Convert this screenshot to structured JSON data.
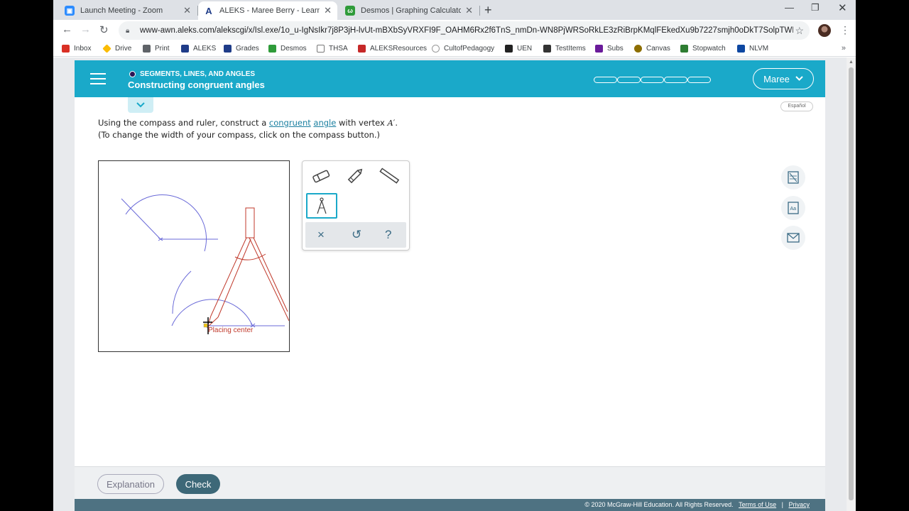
{
  "tabs": [
    {
      "title": "Launch Meeting - Zoom",
      "icon": "zoom-icon",
      "color": "#2d8cff",
      "glyph": "▣"
    },
    {
      "title": "ALEKS - Maree Berry - Learn",
      "icon": "aleks-icon",
      "color": "#1f3c88",
      "glyph": "A"
    },
    {
      "title": "Desmos | Graphing Calculator",
      "icon": "desmos-icon",
      "color": "#2f9b3a",
      "glyph": "ω"
    }
  ],
  "url": "www-awn.aleks.com/alekscgi/x/Isl.exe/1o_u-IgNsIkr7j8P3jH-lvUt-mBXbSyVRXFI9F_OAHM6Rx2f6TnS_nmDn-WN8PjWRSoRkLE3zRiBrpKMqlFEkedXu9b7227smjh0oDkT7SolpTWNTh...",
  "bookmarks": [
    {
      "label": "Inbox",
      "color": "#d93025"
    },
    {
      "label": "Drive",
      "color": "#fbbc04"
    },
    {
      "label": "Print",
      "color": "#5f6368"
    },
    {
      "label": "ALEKS",
      "color": "#1f3c88"
    },
    {
      "label": "Grades",
      "color": "#1f3c88"
    },
    {
      "label": "Desmos",
      "color": "#2f9b3a"
    },
    {
      "label": "THSA",
      "color": "#777777"
    },
    {
      "label": "ALEKSResources",
      "color": "#c62828"
    },
    {
      "label": "CultofPedagogy",
      "color": "#999999"
    },
    {
      "label": "UEN",
      "color": "#222222"
    },
    {
      "label": "TestItems",
      "color": "#333333"
    },
    {
      "label": "Subs",
      "color": "#6a1b9a"
    },
    {
      "label": "Canvas",
      "color": "#8d6e00"
    },
    {
      "label": "Stopwatch",
      "color": "#2e7d32"
    },
    {
      "label": "NLVM",
      "color": "#0d47a1"
    }
  ],
  "header": {
    "topic": "SEGMENTS, LINES, AND ANGLES",
    "title": "Constructing congruent angles",
    "user": "Maree",
    "progress_segments": 5,
    "accent": "#1aa9c9"
  },
  "espanol": "Español",
  "instructions": {
    "pre": "Using the compass and ruler, construct a ",
    "link1": "congruent",
    "link2": "angle",
    "mid": " with vertex ",
    "vertex": "A",
    "prime": "′",
    "post": ".",
    "line2": "(To change the width of your compass, click on the compass button.)"
  },
  "canvas": {
    "tooltip": "Placing center"
  },
  "tools": [
    "eraser-icon",
    "pencil-icon",
    "ruler-icon",
    "compass-icon"
  ],
  "tool_actions": {
    "clear": "×",
    "undo": "↺",
    "help": "?"
  },
  "buttons": {
    "explanation": "Explanation",
    "check": "Check"
  },
  "footer": {
    "copyright": "© 2020 McGraw-Hill Education. All Rights Reserved.",
    "terms": "Terms of Use",
    "sep": "|",
    "privacy": "Privacy"
  }
}
